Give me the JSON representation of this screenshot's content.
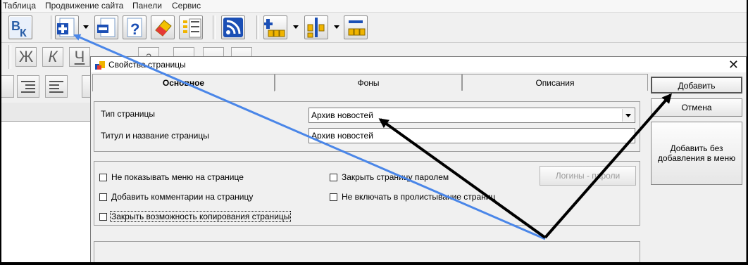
{
  "menu": [
    "Таблица",
    "Продвижение сайта",
    "Панели",
    "Сервис"
  ],
  "toolbar": {
    "icons": [
      "vk-icon",
      "add-page-icon",
      "remove-page-icon",
      "help-icon",
      "eraser-icon",
      "list-icon",
      "rss-icon",
      "add-block-icon",
      "insert-block-icon",
      "remove-block-icon"
    ]
  },
  "format_toolbar": {
    "bold_glyph": "Ж",
    "italic_glyph": "К",
    "underline_glyph": "Ч",
    "extra_glyph": "?"
  },
  "dialog": {
    "title": "Свойства страницы",
    "close_glyph": "✕",
    "tabs": [
      "Основное",
      "Фоны",
      "Описания"
    ],
    "page_type_label": "Тип страницы",
    "page_type_value": "Архив новостей",
    "page_title_label": "Титул и название страницы",
    "page_title_value": "Архив новостей",
    "options": [
      {
        "label": "Не показывать меню на странице",
        "checked": false
      },
      {
        "label": "Закрыть страницу паролем",
        "checked": false
      },
      {
        "label": "Добавить комментарии на страницу",
        "checked": false
      },
      {
        "label": "Не включать в пролистывание страниц",
        "checked": false
      },
      {
        "label": "Закрыть возможность копирования страницы",
        "checked": false
      }
    ],
    "logins_button": "Логины - пароли",
    "add_button": "Добавить",
    "cancel_button": "Отмена",
    "add_without_menu_button": "Добавить без добавления в меню"
  },
  "colors": {
    "annotation_blue": "#4a86e8",
    "annotation_black": "#000000",
    "dialog_bg": "#f0f0f0"
  }
}
